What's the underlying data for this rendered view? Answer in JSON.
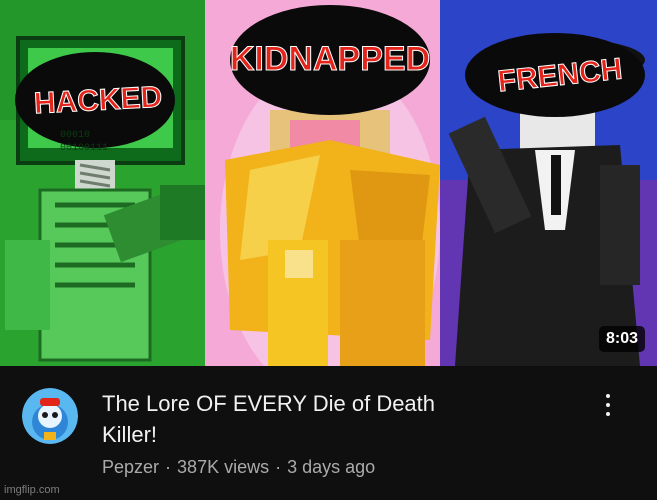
{
  "thumbnail": {
    "labels": [
      "HACKED",
      "KIDNAPPED",
      "FRENCH"
    ],
    "monitor_code": [
      "00010",
      "00100111"
    ],
    "duration": "8:03"
  },
  "video": {
    "title_line1": "The Lore OF EVERY Die of Death",
    "title_line2": "Killer!",
    "channel": "Pepzer",
    "views": "387K views",
    "age": "3 days ago",
    "separator": "·"
  },
  "watermark": "imgflip.com",
  "colors": {
    "background": "#0f0f0f",
    "title_text": "#f1f1f1",
    "meta_text": "#aaaaaa",
    "label_red": "#e3241b",
    "panel_green": "#2aa32f",
    "panel_yellow": "#f2b21a",
    "panel_blue": "#2b44c8"
  }
}
